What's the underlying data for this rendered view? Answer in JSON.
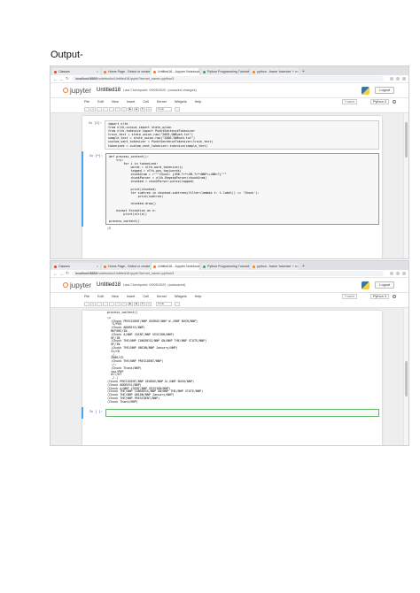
{
  "heading": "Output-",
  "shot1": {
    "tabs": [
      {
        "label": "Classes",
        "color": "#d44638"
      },
      {
        "label": "Home Page - Select or create",
        "color": "#f37726"
      },
      {
        "label": "Untitled18 - Jupyter Notebook",
        "color": "#f37726"
      },
      {
        "label": "Python Programming Tutorials",
        "color": "#34a853"
      },
      {
        "label": "python - frame 'tokenize' + x",
        "color": "#f48024"
      }
    ],
    "active_tab": 2,
    "url_host": "localhost:8888",
    "url_path": "/notebooks/Untitled18.ipynb?kernel_name=python3",
    "notebook_title": "Untitled18",
    "checkpoint": "Last Checkpoint: 09/05/2020",
    "save_status": "(unsaved changes)",
    "logout": "Logout",
    "menus": [
      "File",
      "Edit",
      "View",
      "Insert",
      "Cell",
      "Kernel",
      "Widgets",
      "Help"
    ],
    "trusted": "Trusted",
    "kernel": "Python 3",
    "celltype": "Code",
    "cells": [
      {
        "prompt": "In [1]:",
        "code": "import nltk\nfrom nltk.corpus import state_union\nfrom nltk.tokenize import PunktSentenceTokenizer\ntrain_text = state_union.raw(\"2005-GWBush.txt\")\nsample_text = state_union.raw(\"2006-GWBush.txt\")\ncustom_sent_tokenizer = PunktSentenceTokenizer(train_text)\ntokenized = custom_sent_tokenizer.tokenize(sample_text)"
      },
      {
        "prompt": "In [*]:",
        "code": "def process_content():\n    try:\n        for i in tokenized:\n            words = nltk.word_tokenize(i)\n            tagged = nltk.pos_tag(words)\n            chunkGram = r\"\"\"Chunk: {<RB.?>*<VB.?>*<NNP>+<NN>?}\"\"\"\n            chunkParser = nltk.RegexpParser(chunkGram)\n            chunked = chunkParser.parse(tagged)\n\n            print(chunked)\n            for subtree in chunked.subtrees(filter=lambda t: t.label() == 'Chunk'):\n                print(subtree)\n\n            chunked.draw()\n\n    except Exception as e:\n        print(str(e))\n\nprocess_content()"
      }
    ],
    "output": "(S"
  },
  "shot2": {
    "tabs": [
      {
        "label": "Classes",
        "color": "#d44638"
      },
      {
        "label": "Home Page - Select or create",
        "color": "#f37726"
      },
      {
        "label": "Untitled18 - Jupyter Notebook",
        "color": "#f37726"
      },
      {
        "label": "Python Programming Tutorials",
        "color": "#34a853"
      },
      {
        "label": "python - frame 'tokenize' + x",
        "color": "#f48024"
      }
    ],
    "active_tab": 2,
    "url_host": "localhost:8888",
    "url_path": "/notebooks/Untitled18.ipynb?kernel_name=python3",
    "notebook_title": "Untitled18",
    "checkpoint": "Last Checkpoint: 09/05/2020",
    "save_status": "(autosaved)",
    "logout": "Logout",
    "menus": [
      "File",
      "Edit",
      "View",
      "Insert",
      "Cell",
      "Kernel",
      "Widgets",
      "Help"
    ],
    "trusted": "Trusted",
    "kernel": "Python 3",
    "celltype": "Code",
    "top_line": "process_content()",
    "output": "(S\n  (Chunk PRESIDENT/NNP GEORGE/NNP W./NNP BUSH/NNP)\n  'S/POS\n  (Chunk ADDRESS/NNP)\n  BEFORE/IN\n  (Chunk A/NNP JOINT/NNP SESSION/NNP)\n  OF/IN\n  (Chunk THE/NNP CONGRESS/NNP ON/NNP THE/NNP STATE/NNP)\n  OF/IN\n  (Chunk THE/NNP UNION/NNP January/NNP)\n  31/CD\n  ,/,\n  2006/CD\n  (Chunk THE/NNP PRESIDENT/NNP)\n  :/:\n  (Chunk Thank/NNP)\n  you/PRP\n  all/DT\n  ./.)\n(Chunk PRESIDENT/NNP GEORGE/NNP W./NNP BUSH/NNP)\n(Chunk ADDRESS/NNP)\n(Chunk A/NNP JOINT/NNP SESSION/NNP)\n(Chunk THE/NNP CONGRESS/NNP ON/NNP THE/NNP STATE/NNP)\n(Chunk THE/NNP UNION/NNP January/NNP)\n(Chunk THE/NNP PRESIDENT/NNP)\n(Chunk Thank/NNP)",
    "empty_prompt": "In [ ]:"
  }
}
